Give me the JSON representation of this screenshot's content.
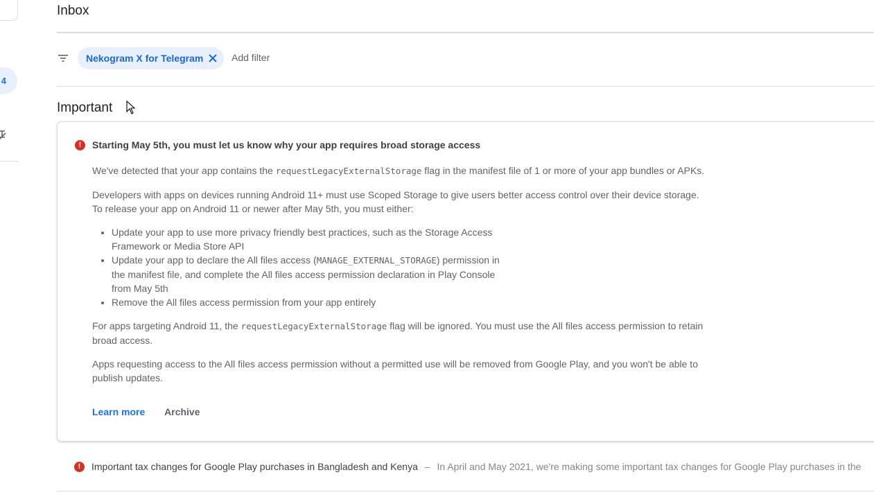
{
  "left_nav": {
    "badge_count": "4"
  },
  "page_title": "Inbox",
  "filters": {
    "chip_label": "Nekogram X for Telegram",
    "add_filter_label": "Add filter"
  },
  "section_title": "Important",
  "important_card": {
    "title": "Starting May 5th, you must let us know why your app requires broad storage access",
    "p1_before": "We've detected that your app contains the ",
    "p1_code": "requestLegacyExternalStorage",
    "p1_after": " flag in the manifest file of 1 or more of your app bundles or APKs.",
    "p2_line1": "Developers with apps on devices running Android 11+ must use Scoped Storage to give users better access control over their device storage.",
    "p2_line2": "To release your app on Android 11 or newer after May 5th, you must either:",
    "bullet1": "Update your app to use more privacy friendly best practices, such as the Storage Access Framework or Media Store API",
    "bullet2_before": "Update your app to declare the All files access (",
    "bullet2_code": "MANAGE_EXTERNAL_STORAGE",
    "bullet2_after": ") permission in the manifest file, and complete the All files access permission declaration in Play Console from May 5th",
    "bullet3": "Remove the All files access permission from your app entirely",
    "p3_before": "For apps targeting Android 11, the ",
    "p3_code": "requestLegacyExternalStorage",
    "p3_after": " flag will be ignored. You must use the All files access permission to retain broad access.",
    "p4": "Apps requesting access to the All files access permission without a permitted use will be removed from Google Play, and you won't be able to publish updates.",
    "learn_more": "Learn more",
    "archive": "Archive"
  },
  "row2": {
    "title": "Important tax changes for Google Play purchases in Bangladesh and Kenya",
    "separator": "–",
    "snippet": "In April and May 2021, we're making some important tax changes for Google Play purchases in the"
  },
  "colors": {
    "accent": "#1a73e8",
    "alert": "#d93025",
    "chip_bg": "#e8f0fe"
  },
  "icons": [
    "filter-icon",
    "close-icon",
    "error-icon",
    "cursor-icon"
  ]
}
